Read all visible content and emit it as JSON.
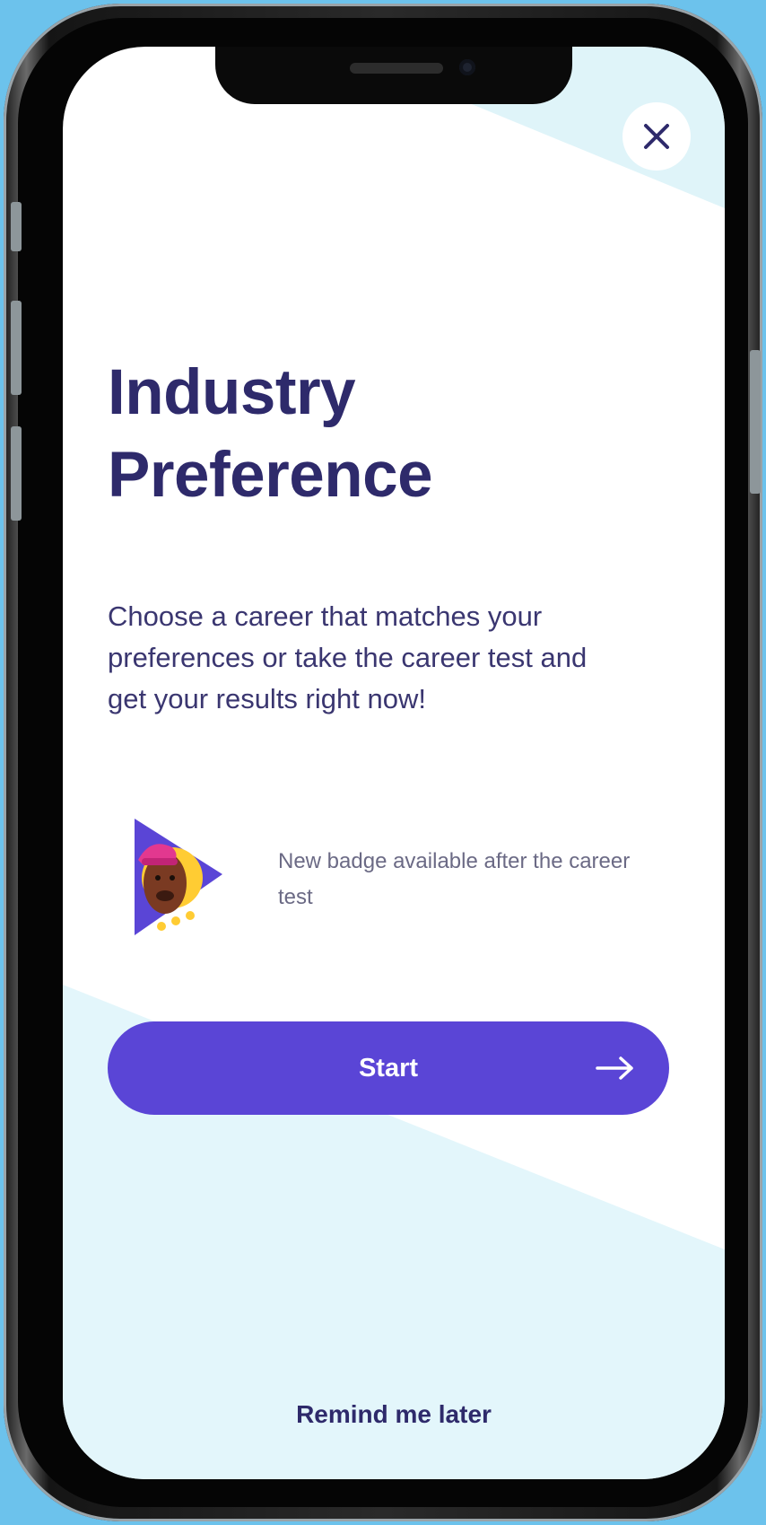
{
  "screen": {
    "title_line1": "Industry",
    "title_line2": "Preference",
    "description": "Choose a career that matches your preferences or take the career test and get your results right now!",
    "badge_text": "New badge available after the career test",
    "start_label": "Start",
    "remind_label": "Remind me later"
  },
  "icons": {
    "close": "close-icon",
    "arrow": "arrow-right-icon",
    "badge": "badge-illustration"
  },
  "colors": {
    "background": "#6cc2ec",
    "title": "#2e2a6b",
    "primary_button": "#5a45d6",
    "screen_tint": "#dff4f9"
  }
}
